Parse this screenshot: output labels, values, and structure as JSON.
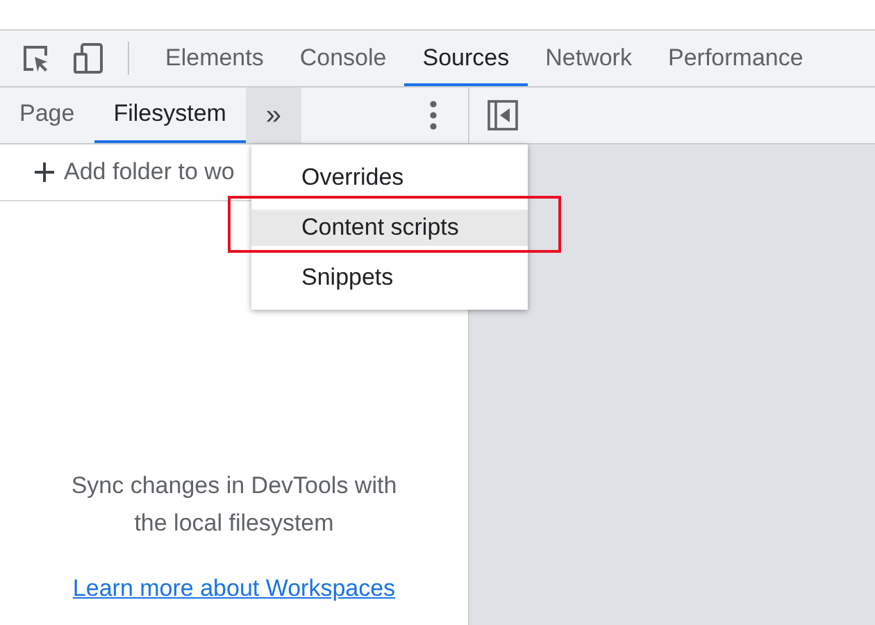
{
  "main_tabs": [
    {
      "label": "Elements",
      "selected": false
    },
    {
      "label": "Console",
      "selected": false
    },
    {
      "label": "Sources",
      "selected": true
    },
    {
      "label": "Network",
      "selected": false
    },
    {
      "label": "Performance",
      "selected": false
    }
  ],
  "navigator_tabs": [
    {
      "label": "Page",
      "selected": false
    },
    {
      "label": "Filesystem",
      "selected": true
    }
  ],
  "more_tabs_button": {
    "label": "»",
    "expanded": true
  },
  "add_folder": {
    "label": "Add folder to wo"
  },
  "empty_state": {
    "message": "Sync changes in DevTools with the local filesystem",
    "link": "Learn more about Workspaces"
  },
  "more_menu": {
    "items": [
      {
        "label": "Overrides",
        "selected": false
      },
      {
        "label": "Content scripts",
        "selected": true
      },
      {
        "label": "Snippets",
        "selected": false
      }
    ]
  }
}
